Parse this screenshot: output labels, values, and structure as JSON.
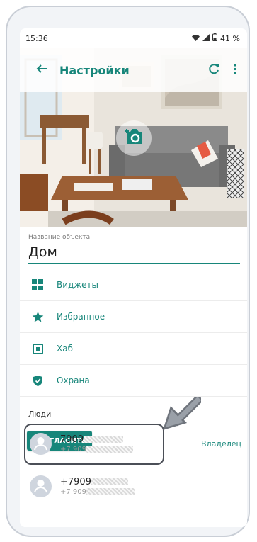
{
  "status": {
    "time": "15:36",
    "battery": "41 %",
    "icons": [
      "wifi-icon",
      "signal-icon",
      "battery-icon"
    ]
  },
  "appbar": {
    "title": "Настройки",
    "back_icon": "arrow-left-icon",
    "refresh_icon": "refresh-icon",
    "more_icon": "more-vertical-icon"
  },
  "hero": {
    "camera_icon": "camera-icon"
  },
  "object": {
    "label": "Название объекта",
    "value": "Дом"
  },
  "menu": {
    "items": [
      {
        "label": "Виджеты",
        "icon": "widgets-icon"
      },
      {
        "label": "Избранное",
        "icon": "star-icon"
      },
      {
        "label": "Хаб",
        "icon": "hub-icon"
      },
      {
        "label": "Охрана",
        "icon": "shield-check-icon"
      }
    ]
  },
  "people": {
    "title": "Люди",
    "invite_label": "ПРИГЛАСИТЬ",
    "items": [
      {
        "name": "7909",
        "phone": "+7 909",
        "role": "Владелец"
      },
      {
        "name": "+7909",
        "phone": "+7 909",
        "role": ""
      }
    ]
  },
  "colors": {
    "accent": "#17867a",
    "annotation": "#4b4f57",
    "avatar": "#cfd5de"
  }
}
